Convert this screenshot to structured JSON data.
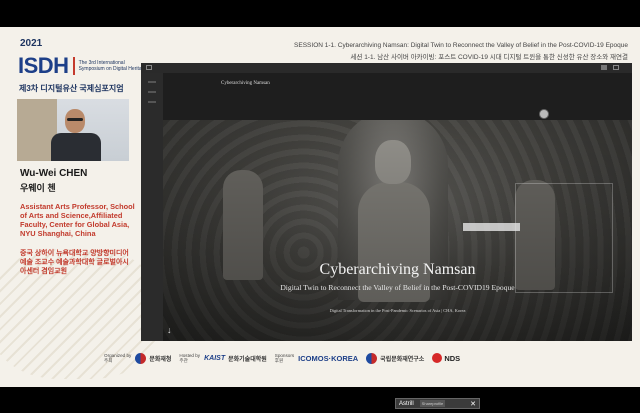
{
  "header": {
    "year": "2021",
    "logo_text": "ISDH",
    "logo_subtitle": "The 3rd International Symposium on Digital Heritage",
    "symposium_ko": "제3차 디지털유산 국제심포지엄",
    "session_en": "SESSION 1-1. Cyberarchiving Namsan: Digital Twin to Reconnect the Valley of Belief in the Post-COVID-19 Epoque",
    "session_ko": "세션 1-1. 남산 사이버 아카이빙: 포스트 COVID-19 시대 디지털 트윈을 통한 신성한 유산 장소와 재연결"
  },
  "speaker": {
    "name": "Wu-Wei CHEN",
    "name_ko": "우웨이 첸",
    "title_en": "Assistant Arts Professor, School of Arts and Science,Affiliated Faculty, Center for Global Asia, NYU Shanghai, China",
    "title_ko": "중국 상하이 뉴욕대학교 양방향미디어예술 조교수 예술과학대학 글로벌아시아센터 겸임교원"
  },
  "shared_screen": {
    "app_title": "Cyberarchiving Namsan",
    "slide_title": "Cyberarchiving Namsan",
    "slide_subtitle": "Digital Twin to Reconnect the Valley of Belief in the Post-COVID19 Epoque",
    "slide_footer": "Digital Transformation in the Post-Pandemic Scenarios of Asia | CHA, Korea",
    "down_arrow": "↓"
  },
  "sponsors": {
    "organized_label": "Organized by",
    "organized_ko": "주최",
    "org1": "문화재청",
    "hosted_label": "Hosted by",
    "hosted_ko": "주관",
    "host1": "KAIST",
    "host2": "문화기술대학원",
    "sponsors_label": "Sponsors",
    "sponsors_ko": "후원",
    "sp1": "ICOMOS·KOREA",
    "sp2": "국립문화재연구소",
    "sp3": "NDS"
  },
  "taskbar": {
    "app_label": "Astrill",
    "share_label": "Shareprofile"
  },
  "colors": {
    "accent_red": "#c23a2c",
    "brand_blue": "#1d3f88",
    "background": "#f4f1ea"
  }
}
